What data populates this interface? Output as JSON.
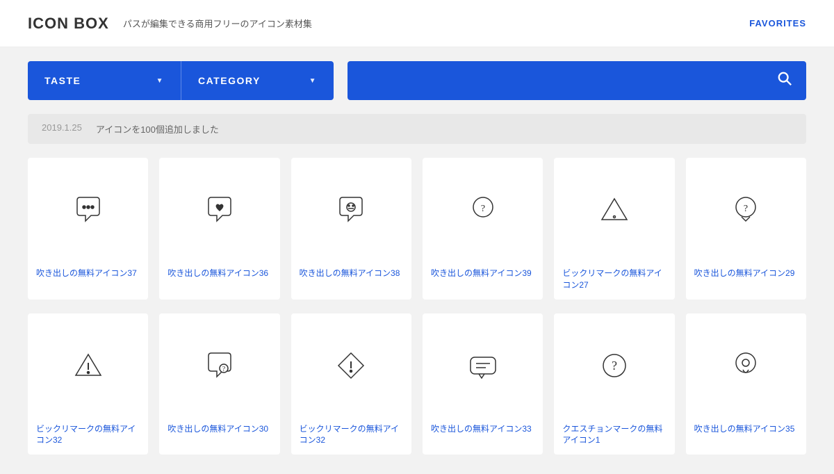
{
  "header": {
    "logo_icon": "ICON",
    "logo_box": "BOX",
    "tagline": "パスが編集できる商用フリーのアイコン素材集",
    "favorites_label": "FAVORITES"
  },
  "filters": {
    "taste_label": "TASTE",
    "category_label": "CATEGORY",
    "search_placeholder": ""
  },
  "notice": {
    "date": "2019.1.25",
    "message": "アイコンを100個追加しました"
  },
  "icons_row1": [
    {
      "label": "吹き出しの無料アイコン37",
      "type": "chat-dots"
    },
    {
      "label": "吹き出しの無料アイコン36",
      "type": "chat-heart"
    },
    {
      "label": "吹き出しの無料アイコン38",
      "type": "chat-minus"
    },
    {
      "label": "吹き出しの無料アイコン39",
      "type": "chat-question"
    },
    {
      "label": "ビックリマークの無料アイコン27",
      "type": "triangle-exclaim"
    },
    {
      "label": "吹き出しの無料アイコン29",
      "type": "chat-question-bubble"
    }
  ],
  "icons_row2": [
    {
      "label": "ビックリマークの無料アイコン32",
      "type": "triangle-exclaim2"
    },
    {
      "label": "吹き出しの無料アイコン30",
      "type": "chat-question2"
    },
    {
      "label": "ビックリマークの無料アイコン32",
      "type": "diamond-exclaim"
    },
    {
      "label": "吹き出しの無料アイコン33",
      "type": "chat-flat"
    },
    {
      "label": "クエスチョンマークの無料アイコン1",
      "type": "circle-question"
    },
    {
      "label": "吹き出しの無料アイコン35",
      "type": "chat-pin"
    }
  ]
}
